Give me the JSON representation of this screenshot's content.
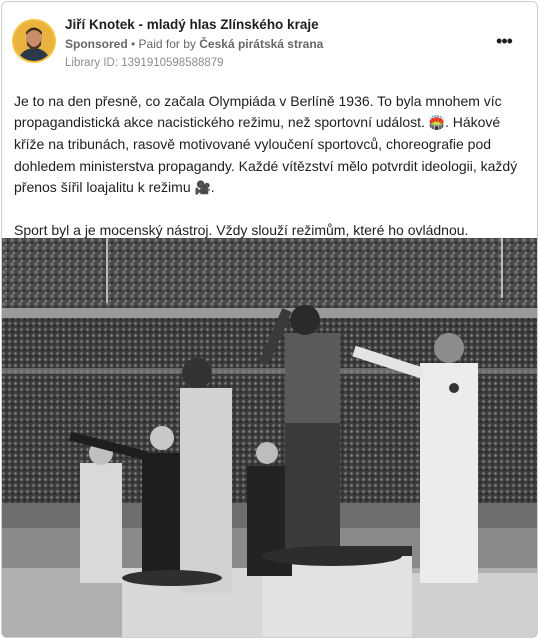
{
  "post": {
    "author": "Jiří Knotek - mladý hlas Zlínského kraje",
    "sponsored_label": "Sponsored",
    "separator": " • ",
    "paid_for_label": "Paid for by ",
    "funder": "Česká pirátská strana",
    "library_id": "Library ID: 1391910598588879",
    "more_icon": "more-horizontal-icon",
    "paragraph_1_a": "Je to na den přesně, co začala Olympiáda v Berlíně 1936. To byla mnohem víc propagandistická akce nacistického režimu, než sportovní událost. ",
    "emoji_1": "🏟️",
    "paragraph_1_b": ". Hákové kříže na tribunách, rasově motivované vyloučení sportovců, choreografie pod dohledem ministerstva propagandy. Každé vítězství mělo potvrdit ideologii, každý přenos šířil loajalitu k režimu ",
    "emoji_2": "🎥",
    "paragraph_1_c": ".",
    "paragraph_2": "Sport byl a je mocenský nástroj. Vždy slouží režimům, které ho ovládnou. Stejně…"
  },
  "media": {
    "photo_icon": "black-and-white-olympic-podium-photo"
  }
}
